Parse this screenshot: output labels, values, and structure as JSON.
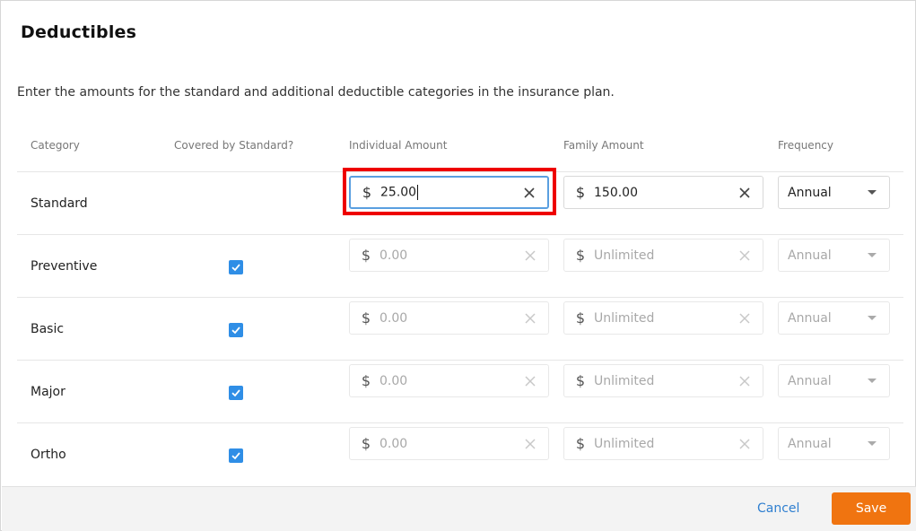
{
  "dialog": {
    "title": "Deductibles",
    "description": "Enter the amounts for the standard and additional deductible categories in the insurance plan."
  },
  "table": {
    "headers": {
      "category": "Category",
      "covered": "Covered by Standard?",
      "individual": "Individual Amount",
      "family": "Family Amount",
      "frequency": "Frequency"
    },
    "rows": [
      {
        "category": "Standard",
        "covered": null,
        "individual": "25.00",
        "family": "150.00",
        "frequency": "Annual",
        "disabled": false
      },
      {
        "category": "Preventive",
        "covered": true,
        "individual": "0.00",
        "family": "Unlimited",
        "frequency": "Annual",
        "disabled": true
      },
      {
        "category": "Basic",
        "covered": true,
        "individual": "0.00",
        "family": "Unlimited",
        "frequency": "Annual",
        "disabled": true
      },
      {
        "category": "Major",
        "covered": true,
        "individual": "0.00",
        "family": "Unlimited",
        "frequency": "Annual",
        "disabled": true
      },
      {
        "category": "Ortho",
        "covered": true,
        "individual": "0.00",
        "family": "Unlimited",
        "frequency": "Annual",
        "disabled": true
      }
    ]
  },
  "currency_symbol": "$",
  "footer": {
    "cancel_label": "Cancel",
    "save_label": "Save"
  },
  "colors": {
    "accent": "#f07410",
    "link": "#2f7fd0",
    "checkbox": "#2f8ee6",
    "highlight": "#ee0000"
  },
  "icons": {
    "clear": "close-icon",
    "dropdown": "chevron-down-icon",
    "check": "check-icon"
  }
}
